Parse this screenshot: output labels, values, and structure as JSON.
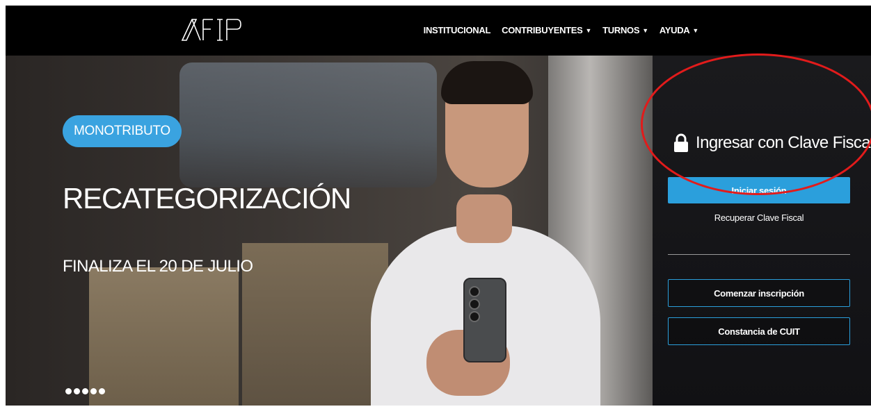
{
  "header": {
    "logo_text": "AFIP",
    "nav": [
      {
        "label": "INSTITUCIONAL",
        "has_dropdown": false
      },
      {
        "label": "CONTRIBUYENTES",
        "has_dropdown": true
      },
      {
        "label": "TURNOS",
        "has_dropdown": true
      },
      {
        "label": "AYUDA",
        "has_dropdown": true
      }
    ]
  },
  "hero": {
    "badge": "MONOTRIBUTO",
    "headline": "RECATEGORIZACIÓN",
    "subhead": "FINALIZA EL 20 DE JULIO",
    "slide_count": 5,
    "active_slide": 1
  },
  "login": {
    "title": "Ingresar con Clave Fiscal",
    "primary_button": "Iniciar sesión",
    "recover_link": "Recuperar Clave Fiscal"
  },
  "actions": {
    "start_registration": "Comenzar inscripción",
    "cuit_certificate": "Constancia de CUIT"
  },
  "colors": {
    "accent": "#2b9fdc",
    "badge": "#3aa3e0",
    "highlight": "#e21b1b"
  }
}
